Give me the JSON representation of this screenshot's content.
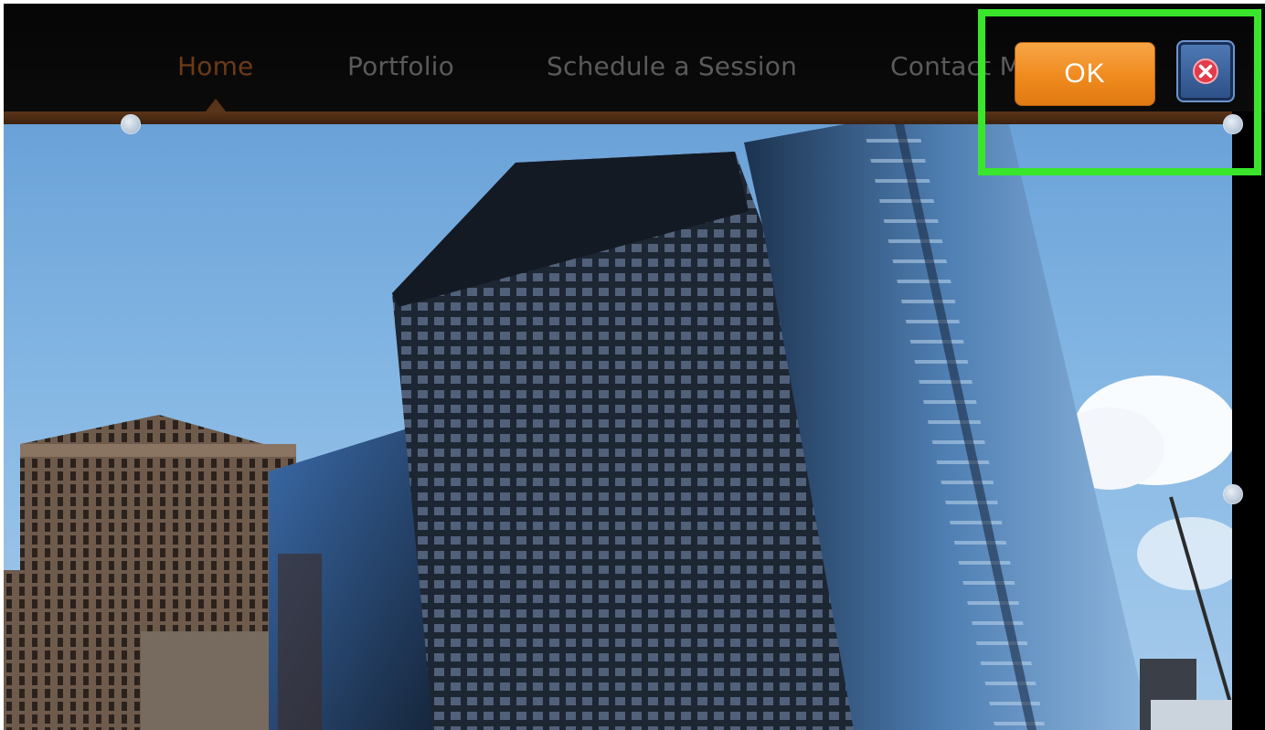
{
  "nav": {
    "items": [
      {
        "label": "Home",
        "active": true
      },
      {
        "label": "Portfolio",
        "active": false
      },
      {
        "label": "Schedule a Session",
        "active": false
      },
      {
        "label": "Contact Me",
        "active": false
      }
    ]
  },
  "dialog": {
    "ok_label": "OK",
    "close_icon": "close-icon"
  },
  "colors": {
    "ok_button": "#ef8a1e",
    "close_button": "#2c4f86",
    "highlight": "#39e62b",
    "active_nav": "#6b3a17"
  }
}
